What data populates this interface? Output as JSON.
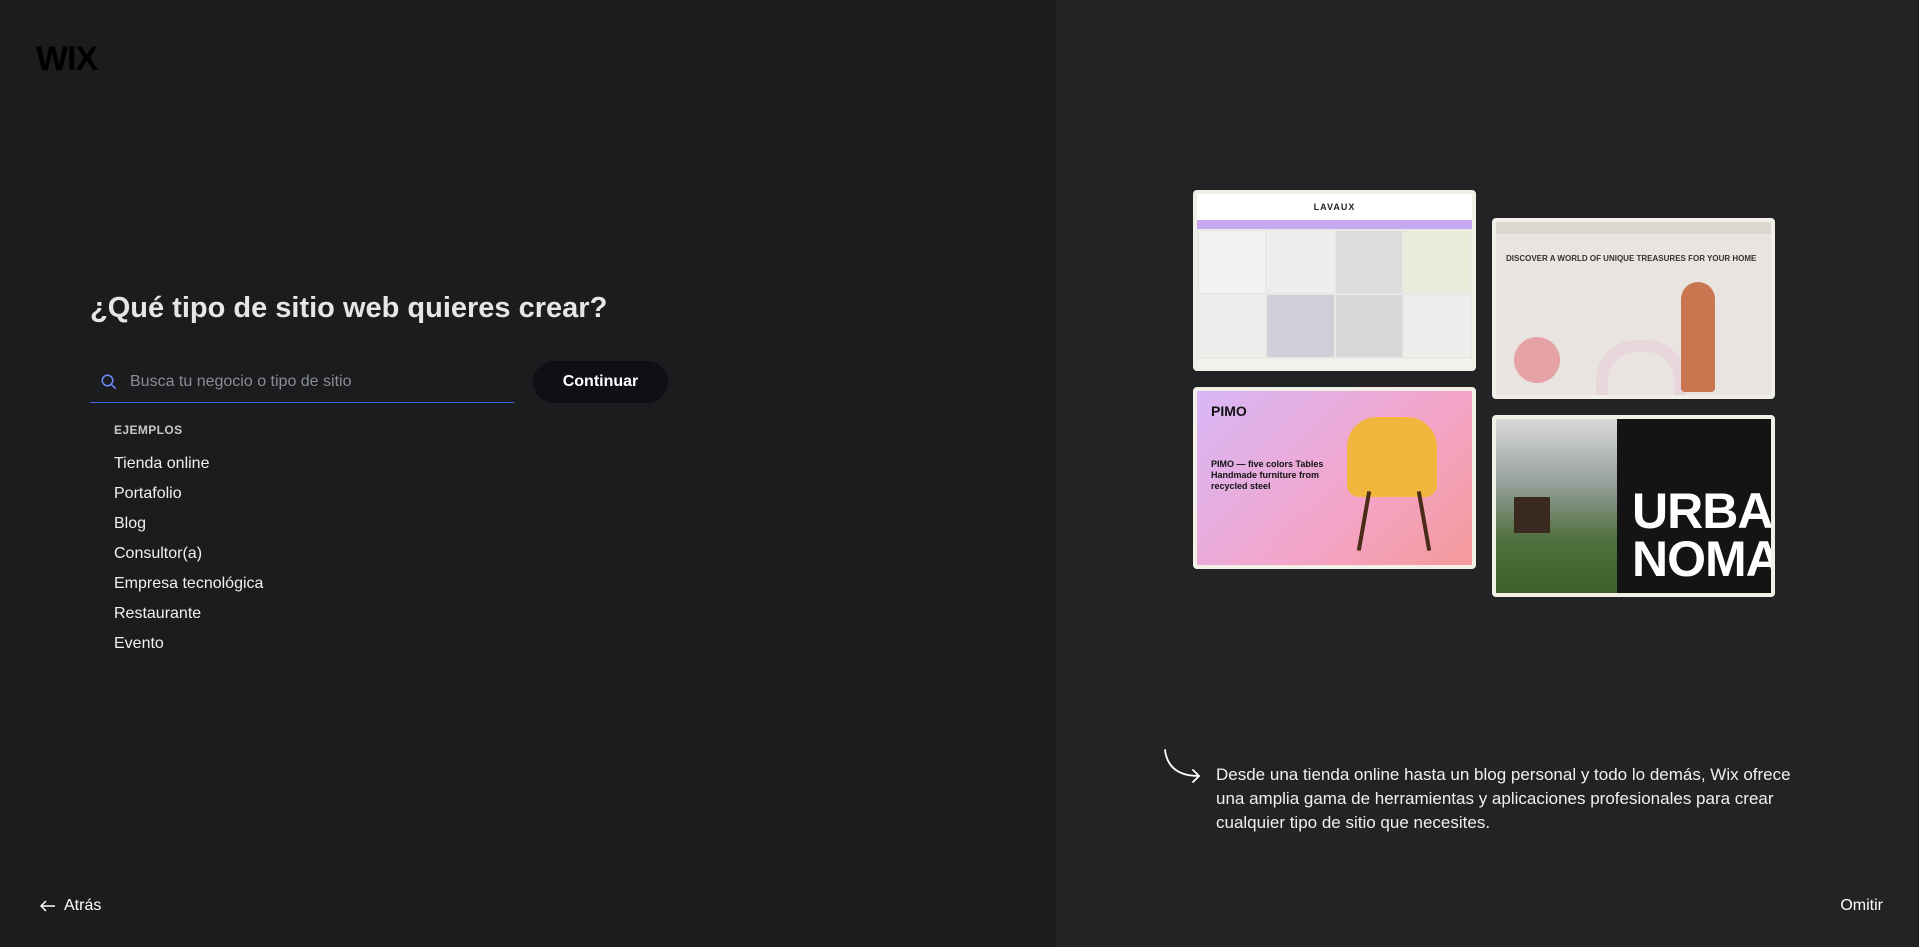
{
  "brand": "WIX",
  "headline": "¿Qué tipo de sitio web quieres crear?",
  "search": {
    "placeholder": "Busca tu negocio o tipo de sitio",
    "value": ""
  },
  "continue_label": "Continuar",
  "examples": {
    "title": "EJEMPLOS",
    "items": [
      "Tienda online",
      "Portafolio",
      "Blog",
      "Consultor(a)",
      "Empresa tecnológica",
      "Restaurante",
      "Evento"
    ]
  },
  "back_label": "Atrás",
  "skip_label": "Omitir",
  "preview": {
    "card1_brand": "LAVAUX",
    "card2_heading": "DISCOVER A WORLD OF UNIQUE TREASURES FOR YOUR HOME",
    "card3_brand": "PIMO",
    "card3_copy": "PIMO — five colors Tables Handmade furniture from recycled steel",
    "card4_title": "URBAN NOMAD"
  },
  "caption": "Desde una tienda online hasta un blog personal y todo lo demás, Wix ofrece una amplia gama de herramientas y aplicaciones profesionales para crear cualquier tipo de sitio que necesites.",
  "colors": {
    "accent": "#3e63dd",
    "button_bg": "#0f1016",
    "left_bg": "#1b1c1e",
    "right_bg": "#222325"
  }
}
